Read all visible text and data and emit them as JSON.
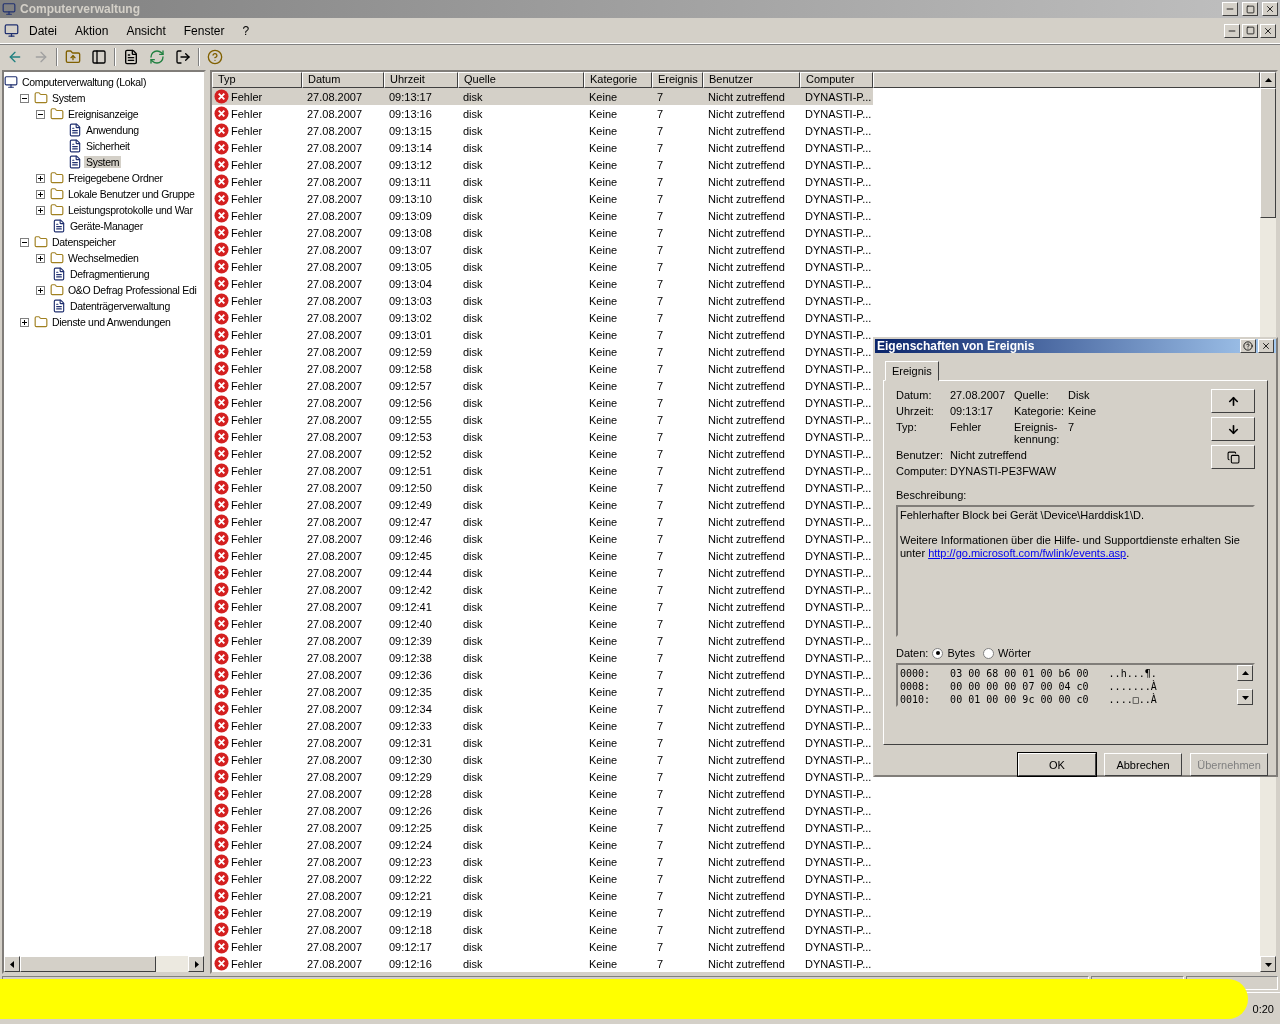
{
  "window": {
    "title": "Computerverwaltung"
  },
  "menu": [
    "Datei",
    "Aktion",
    "Ansicht",
    "Fenster",
    "?"
  ],
  "tree": [
    {
      "label": "Computerverwaltung (Lokal)",
      "kind": "root",
      "selected": false,
      "children": [
        {
          "label": "System",
          "kind": "folder",
          "expanded": true,
          "selected": false,
          "children": [
            {
              "label": "Ereignisanzeige",
              "kind": "folder",
              "expanded": true,
              "selected": false,
              "children": [
                {
                  "label": "Anwendung",
                  "kind": "leaf",
                  "selected": false
                },
                {
                  "label": "Sicherheit",
                  "kind": "leaf",
                  "selected": false
                },
                {
                  "label": "System",
                  "kind": "leaf",
                  "selected": true
                }
              ]
            },
            {
              "label": "Freigegebene Ordner",
              "kind": "folder",
              "expanded": false,
              "selected": false
            },
            {
              "label": "Lokale Benutzer und Gruppe",
              "kind": "folder",
              "expanded": false,
              "selected": false
            },
            {
              "label": "Leistungsprotokolle und War",
              "kind": "folder",
              "expanded": false,
              "selected": false
            },
            {
              "label": "Geräte-Manager",
              "kind": "leaf",
              "selected": false
            }
          ]
        },
        {
          "label": "Datenspeicher",
          "kind": "folder",
          "expanded": true,
          "selected": false,
          "children": [
            {
              "label": "Wechselmedien",
              "kind": "folder",
              "expanded": false,
              "selected": false
            },
            {
              "label": "Defragmentierung",
              "kind": "leaf",
              "selected": false
            },
            {
              "label": "O&O Defrag Professional Edi",
              "kind": "folder",
              "expanded": false,
              "selected": false
            },
            {
              "label": "Datenträgerverwaltung",
              "kind": "leaf",
              "selected": false
            }
          ]
        },
        {
          "label": "Dienste und Anwendungen",
          "kind": "folder",
          "expanded": false,
          "selected": false
        }
      ]
    }
  ],
  "table": {
    "columns": [
      "Typ",
      "Datum",
      "Uhrzeit",
      "Quelle",
      "Kategorie",
      "Ereignis",
      "Benutzer",
      "Computer"
    ],
    "rows": [
      {
        "cells": [
          "Fehler",
          "27.08.2007",
          "09:13:17",
          "disk",
          "Keine",
          "7",
          "Nicht zutreffend",
          "DYNASTI-P..."
        ],
        "selected": true
      },
      {
        "cells": [
          "Fehler",
          "27.08.2007",
          "09:13:16",
          "disk",
          "Keine",
          "7",
          "Nicht zutreffend",
          "DYNASTI-P..."
        ],
        "selected": false
      },
      {
        "cells": [
          "Fehler",
          "27.08.2007",
          "09:13:15",
          "disk",
          "Keine",
          "7",
          "Nicht zutreffend",
          "DYNASTI-P..."
        ],
        "selected": false
      },
      {
        "cells": [
          "Fehler",
          "27.08.2007",
          "09:13:14",
          "disk",
          "Keine",
          "7",
          "Nicht zutreffend",
          "DYNASTI-P..."
        ],
        "selected": false
      },
      {
        "cells": [
          "Fehler",
          "27.08.2007",
          "09:13:12",
          "disk",
          "Keine",
          "7",
          "Nicht zutreffend",
          "DYNASTI-P..."
        ],
        "selected": false
      },
      {
        "cells": [
          "Fehler",
          "27.08.2007",
          "09:13:11",
          "disk",
          "Keine",
          "7",
          "Nicht zutreffend",
          "DYNASTI-P..."
        ],
        "selected": false
      },
      {
        "cells": [
          "Fehler",
          "27.08.2007",
          "09:13:10",
          "disk",
          "Keine",
          "7",
          "Nicht zutreffend",
          "DYNASTI-P..."
        ],
        "selected": false
      },
      {
        "cells": [
          "Fehler",
          "27.08.2007",
          "09:13:09",
          "disk",
          "Keine",
          "7",
          "Nicht zutreffend",
          "DYNASTI-P..."
        ],
        "selected": false
      },
      {
        "cells": [
          "Fehler",
          "27.08.2007",
          "09:13:08",
          "disk",
          "Keine",
          "7",
          "Nicht zutreffend",
          "DYNASTI-P..."
        ],
        "selected": false
      },
      {
        "cells": [
          "Fehler",
          "27.08.2007",
          "09:13:07",
          "disk",
          "Keine",
          "7",
          "Nicht zutreffend",
          "DYNASTI-P..."
        ],
        "selected": false
      },
      {
        "cells": [
          "Fehler",
          "27.08.2007",
          "09:13:05",
          "disk",
          "Keine",
          "7",
          "Nicht zutreffend",
          "DYNASTI-P..."
        ],
        "selected": false
      },
      {
        "cells": [
          "Fehler",
          "27.08.2007",
          "09:13:04",
          "disk",
          "Keine",
          "7",
          "Nicht zutreffend",
          "DYNASTI-P..."
        ],
        "selected": false
      },
      {
        "cells": [
          "Fehler",
          "27.08.2007",
          "09:13:03",
          "disk",
          "Keine",
          "7",
          "Nicht zutreffend",
          "DYNASTI-P..."
        ],
        "selected": false
      },
      {
        "cells": [
          "Fehler",
          "27.08.2007",
          "09:13:02",
          "disk",
          "Keine",
          "7",
          "Nicht zutreffend",
          "DYNASTI-P..."
        ],
        "selected": false
      },
      {
        "cells": [
          "Fehler",
          "27.08.2007",
          "09:13:01",
          "disk",
          "Keine",
          "7",
          "Nicht zutreffend",
          "DYNASTI-P..."
        ],
        "selected": false
      },
      {
        "cells": [
          "Fehler",
          "27.08.2007",
          "09:12:59",
          "disk",
          "Keine",
          "7",
          "Nicht zutreffend",
          "DYNASTI-P..."
        ],
        "selected": false
      },
      {
        "cells": [
          "Fehler",
          "27.08.2007",
          "09:12:58",
          "disk",
          "Keine",
          "7",
          "Nicht zutreffend",
          "DYNASTI-P..."
        ],
        "selected": false
      },
      {
        "cells": [
          "Fehler",
          "27.08.2007",
          "09:12:57",
          "disk",
          "Keine",
          "7",
          "Nicht zutreffend",
          "DYNASTI-P..."
        ],
        "selected": false
      },
      {
        "cells": [
          "Fehler",
          "27.08.2007",
          "09:12:56",
          "disk",
          "Keine",
          "7",
          "Nicht zutreffend",
          "DYNASTI-P..."
        ],
        "selected": false
      },
      {
        "cells": [
          "Fehler",
          "27.08.2007",
          "09:12:55",
          "disk",
          "Keine",
          "7",
          "Nicht zutreffend",
          "DYNASTI-P..."
        ],
        "selected": false
      },
      {
        "cells": [
          "Fehler",
          "27.08.2007",
          "09:12:53",
          "disk",
          "Keine",
          "7",
          "Nicht zutreffend",
          "DYNASTI-P..."
        ],
        "selected": false
      },
      {
        "cells": [
          "Fehler",
          "27.08.2007",
          "09:12:52",
          "disk",
          "Keine",
          "7",
          "Nicht zutreffend",
          "DYNASTI-P..."
        ],
        "selected": false
      },
      {
        "cells": [
          "Fehler",
          "27.08.2007",
          "09:12:51",
          "disk",
          "Keine",
          "7",
          "Nicht zutreffend",
          "DYNASTI-P..."
        ],
        "selected": false
      },
      {
        "cells": [
          "Fehler",
          "27.08.2007",
          "09:12:50",
          "disk",
          "Keine",
          "7",
          "Nicht zutreffend",
          "DYNASTI-P..."
        ],
        "selected": false
      },
      {
        "cells": [
          "Fehler",
          "27.08.2007",
          "09:12:49",
          "disk",
          "Keine",
          "7",
          "Nicht zutreffend",
          "DYNASTI-P..."
        ],
        "selected": false
      },
      {
        "cells": [
          "Fehler",
          "27.08.2007",
          "09:12:47",
          "disk",
          "Keine",
          "7",
          "Nicht zutreffend",
          "DYNASTI-P..."
        ],
        "selected": false
      },
      {
        "cells": [
          "Fehler",
          "27.08.2007",
          "09:12:46",
          "disk",
          "Keine",
          "7",
          "Nicht zutreffend",
          "DYNASTI-P..."
        ],
        "selected": false
      },
      {
        "cells": [
          "Fehler",
          "27.08.2007",
          "09:12:45",
          "disk",
          "Keine",
          "7",
          "Nicht zutreffend",
          "DYNASTI-P..."
        ],
        "selected": false
      },
      {
        "cells": [
          "Fehler",
          "27.08.2007",
          "09:12:44",
          "disk",
          "Keine",
          "7",
          "Nicht zutreffend",
          "DYNASTI-P..."
        ],
        "selected": false
      },
      {
        "cells": [
          "Fehler",
          "27.08.2007",
          "09:12:42",
          "disk",
          "Keine",
          "7",
          "Nicht zutreffend",
          "DYNASTI-P..."
        ],
        "selected": false
      },
      {
        "cells": [
          "Fehler",
          "27.08.2007",
          "09:12:41",
          "disk",
          "Keine",
          "7",
          "Nicht zutreffend",
          "DYNASTI-P..."
        ],
        "selected": false
      },
      {
        "cells": [
          "Fehler",
          "27.08.2007",
          "09:12:40",
          "disk",
          "Keine",
          "7",
          "Nicht zutreffend",
          "DYNASTI-P..."
        ],
        "selected": false
      },
      {
        "cells": [
          "Fehler",
          "27.08.2007",
          "09:12:39",
          "disk",
          "Keine",
          "7",
          "Nicht zutreffend",
          "DYNASTI-P..."
        ],
        "selected": false
      },
      {
        "cells": [
          "Fehler",
          "27.08.2007",
          "09:12:38",
          "disk",
          "Keine",
          "7",
          "Nicht zutreffend",
          "DYNASTI-P..."
        ],
        "selected": false
      },
      {
        "cells": [
          "Fehler",
          "27.08.2007",
          "09:12:36",
          "disk",
          "Keine",
          "7",
          "Nicht zutreffend",
          "DYNASTI-P..."
        ],
        "selected": false
      },
      {
        "cells": [
          "Fehler",
          "27.08.2007",
          "09:12:35",
          "disk",
          "Keine",
          "7",
          "Nicht zutreffend",
          "DYNASTI-P..."
        ],
        "selected": false
      },
      {
        "cells": [
          "Fehler",
          "27.08.2007",
          "09:12:34",
          "disk",
          "Keine",
          "7",
          "Nicht zutreffend",
          "DYNASTI-P..."
        ],
        "selected": false
      },
      {
        "cells": [
          "Fehler",
          "27.08.2007",
          "09:12:33",
          "disk",
          "Keine",
          "7",
          "Nicht zutreffend",
          "DYNASTI-P..."
        ],
        "selected": false
      },
      {
        "cells": [
          "Fehler",
          "27.08.2007",
          "09:12:31",
          "disk",
          "Keine",
          "7",
          "Nicht zutreffend",
          "DYNASTI-P..."
        ],
        "selected": false
      },
      {
        "cells": [
          "Fehler",
          "27.08.2007",
          "09:12:30",
          "disk",
          "Keine",
          "7",
          "Nicht zutreffend",
          "DYNASTI-P..."
        ],
        "selected": false
      },
      {
        "cells": [
          "Fehler",
          "27.08.2007",
          "09:12:29",
          "disk",
          "Keine",
          "7",
          "Nicht zutreffend",
          "DYNASTI-P..."
        ],
        "selected": false
      },
      {
        "cells": [
          "Fehler",
          "27.08.2007",
          "09:12:28",
          "disk",
          "Keine",
          "7",
          "Nicht zutreffend",
          "DYNASTI-P..."
        ],
        "selected": false
      },
      {
        "cells": [
          "Fehler",
          "27.08.2007",
          "09:12:26",
          "disk",
          "Keine",
          "7",
          "Nicht zutreffend",
          "DYNASTI-P..."
        ],
        "selected": false
      },
      {
        "cells": [
          "Fehler",
          "27.08.2007",
          "09:12:25",
          "disk",
          "Keine",
          "7",
          "Nicht zutreffend",
          "DYNASTI-P..."
        ],
        "selected": false
      },
      {
        "cells": [
          "Fehler",
          "27.08.2007",
          "09:12:24",
          "disk",
          "Keine",
          "7",
          "Nicht zutreffend",
          "DYNASTI-P..."
        ],
        "selected": false
      },
      {
        "cells": [
          "Fehler",
          "27.08.2007",
          "09:12:23",
          "disk",
          "Keine",
          "7",
          "Nicht zutreffend",
          "DYNASTI-P..."
        ],
        "selected": false
      },
      {
        "cells": [
          "Fehler",
          "27.08.2007",
          "09:12:22",
          "disk",
          "Keine",
          "7",
          "Nicht zutreffend",
          "DYNASTI-P..."
        ],
        "selected": false
      },
      {
        "cells": [
          "Fehler",
          "27.08.2007",
          "09:12:21",
          "disk",
          "Keine",
          "7",
          "Nicht zutreffend",
          "DYNASTI-P..."
        ],
        "selected": false
      },
      {
        "cells": [
          "Fehler",
          "27.08.2007",
          "09:12:19",
          "disk",
          "Keine",
          "7",
          "Nicht zutreffend",
          "DYNASTI-P..."
        ],
        "selected": false
      },
      {
        "cells": [
          "Fehler",
          "27.08.2007",
          "09:12:18",
          "disk",
          "Keine",
          "7",
          "Nicht zutreffend",
          "DYNASTI-P..."
        ],
        "selected": false
      },
      {
        "cells": [
          "Fehler",
          "27.08.2007",
          "09:12:17",
          "disk",
          "Keine",
          "7",
          "Nicht zutreffend",
          "DYNASTI-P..."
        ],
        "selected": false
      },
      {
        "cells": [
          "Fehler",
          "27.08.2007",
          "09:12:16",
          "disk",
          "Keine",
          "7",
          "Nicht zutreffend",
          "DYNASTI-P..."
        ],
        "selected": false
      }
    ]
  },
  "dialog": {
    "title": "Eigenschaften von Ereignis",
    "tabs": [
      {
        "label": "Ereignis",
        "selected": true
      }
    ],
    "fields": [
      {
        "label": "Datum:",
        "value": "27.08.2007",
        "label2": "Quelle:",
        "value2": "Disk"
      },
      {
        "label": "Uhrzeit:",
        "value": "09:13:17",
        "label2": "Kategorie:",
        "value2": "Keine"
      },
      {
        "label": "Typ:",
        "value": "Fehler",
        "label2": "Ereignis-\nkennung:",
        "value2": "7"
      },
      {
        "label": "Benutzer:",
        "value": "Nicht zutreffend"
      },
      {
        "label": "Computer:",
        "value": "DYNASTI-PE3FWAW"
      }
    ],
    "description_label": "Beschreibung:",
    "description": {
      "first": "Fehlerhafter Block bei Gerät \\Device\\Harddisk1\\D.",
      "more": "Weitere Informationen über die Hilfe- und Supportdienste erhalten Sie unter",
      "link": "http://go.microsoft.com/fwlink/events.asp",
      "end": "."
    },
    "data_label": "Daten:",
    "data_modes": [
      {
        "label": "Bytes",
        "selected": true
      },
      {
        "label": "Wörter",
        "selected": false
      }
    ],
    "hex": [
      {
        "offset": "0000:",
        "bytes": "03 00 68 00 01 00 b6 00",
        "chars": "..h...¶."
      },
      {
        "offset": "0008:",
        "bytes": "00 00 00 00 07 00 04 c0",
        "chars": ".......À"
      },
      {
        "offset": "0010:",
        "bytes": "00 01 00 00 9c 00 00 c0",
        "chars": "....□..À"
      }
    ],
    "buttons": [
      {
        "label": "OK",
        "disabled": false
      },
      {
        "label": "Abbrechen",
        "disabled": false
      },
      {
        "label": "Übernehmen",
        "disabled": true
      }
    ]
  },
  "taskbar": {
    "clock": "0:20"
  }
}
